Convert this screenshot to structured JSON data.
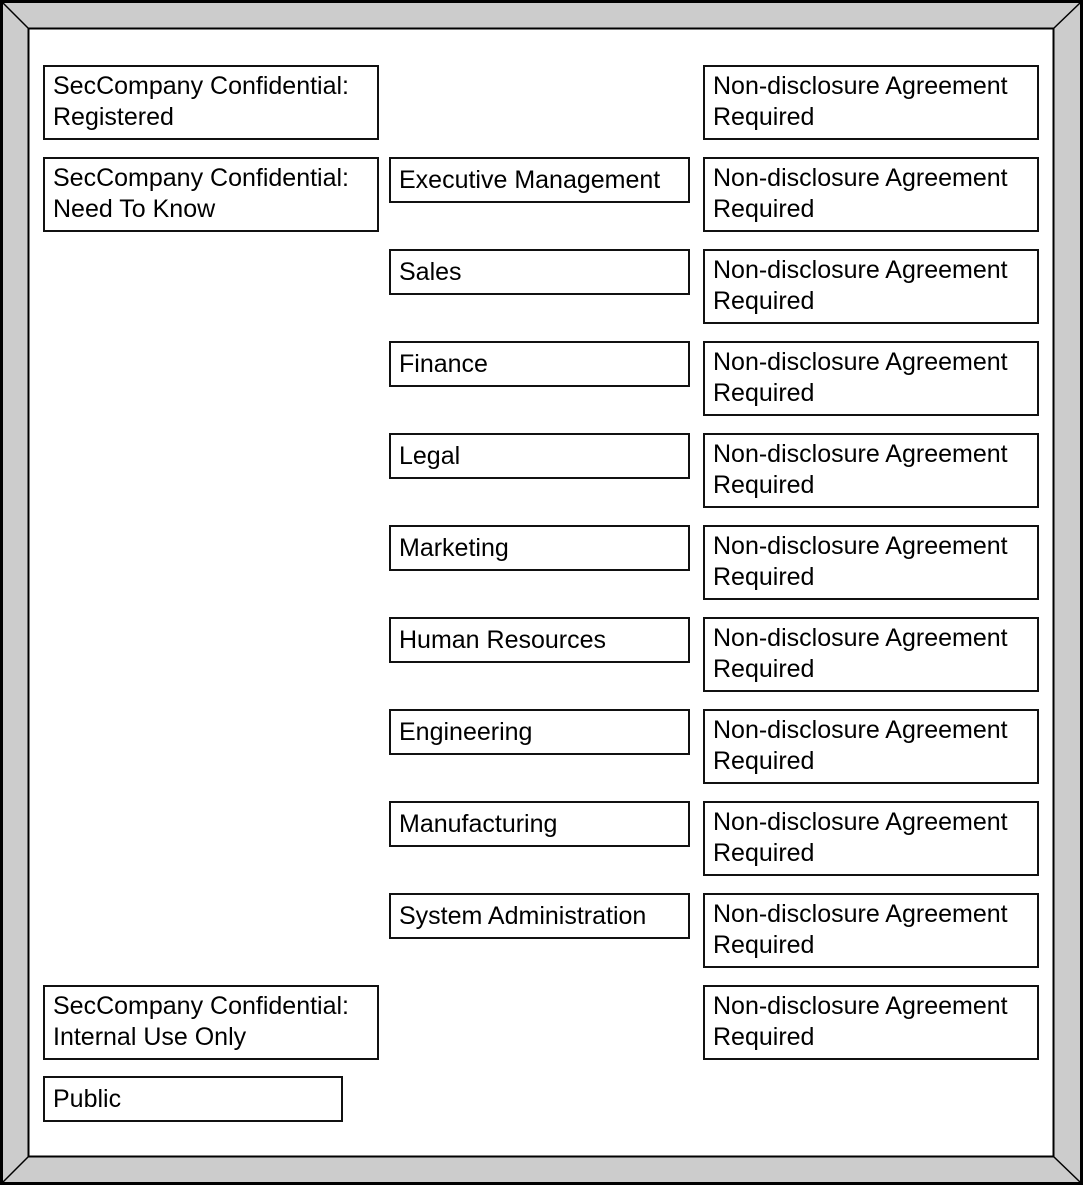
{
  "diagram": {
    "frame_colors": {
      "bevel": "#cccccc",
      "outline": "#000000",
      "box_border": "#111111"
    },
    "rows": [
      {
        "level": {
          "lines": [
            "SecCompany Confidential:",
            "Registered"
          ]
        },
        "category": null,
        "caveat": {
          "lines": [
            "Non-disclosure Agreement",
            "Required"
          ]
        }
      },
      {
        "level": {
          "lines": [
            "SecCompany Confidential:",
            "Need To Know"
          ]
        },
        "category": {
          "label": "Executive Management"
        },
        "caveat": {
          "lines": [
            "Non-disclosure Agreement",
            "Required"
          ]
        }
      },
      {
        "level": null,
        "category": {
          "label": "Sales"
        },
        "caveat": {
          "lines": [
            "Non-disclosure Agreement",
            "Required"
          ]
        }
      },
      {
        "level": null,
        "category": {
          "label": "Finance"
        },
        "caveat": {
          "lines": [
            "Non-disclosure Agreement",
            "Required"
          ]
        }
      },
      {
        "level": null,
        "category": {
          "label": "Legal"
        },
        "caveat": {
          "lines": [
            "Non-disclosure Agreement",
            "Required"
          ]
        }
      },
      {
        "level": null,
        "category": {
          "label": "Marketing"
        },
        "caveat": {
          "lines": [
            "Non-disclosure Agreement",
            "Required"
          ]
        }
      },
      {
        "level": null,
        "category": {
          "label": "Human Resources"
        },
        "caveat": {
          "lines": [
            "Non-disclosure Agreement",
            "Required"
          ]
        }
      },
      {
        "level": null,
        "category": {
          "label": "Engineering"
        },
        "caveat": {
          "lines": [
            "Non-disclosure Agreement",
            "Required"
          ]
        }
      },
      {
        "level": null,
        "category": {
          "label": "Manufacturing"
        },
        "caveat": {
          "lines": [
            "Non-disclosure Agreement",
            "Required"
          ]
        }
      },
      {
        "level": null,
        "category": {
          "label": "System Administration"
        },
        "caveat": {
          "lines": [
            "Non-disclosure Agreement",
            "Required"
          ]
        }
      },
      {
        "level": {
          "lines": [
            "SecCompany Confidential:",
            "Internal Use Only"
          ]
        },
        "category": null,
        "caveat": {
          "lines": [
            "Non-disclosure Agreement",
            "Required"
          ]
        }
      },
      {
        "level": {
          "lines": [
            "Public"
          ]
        },
        "category": null,
        "caveat": null
      }
    ]
  }
}
